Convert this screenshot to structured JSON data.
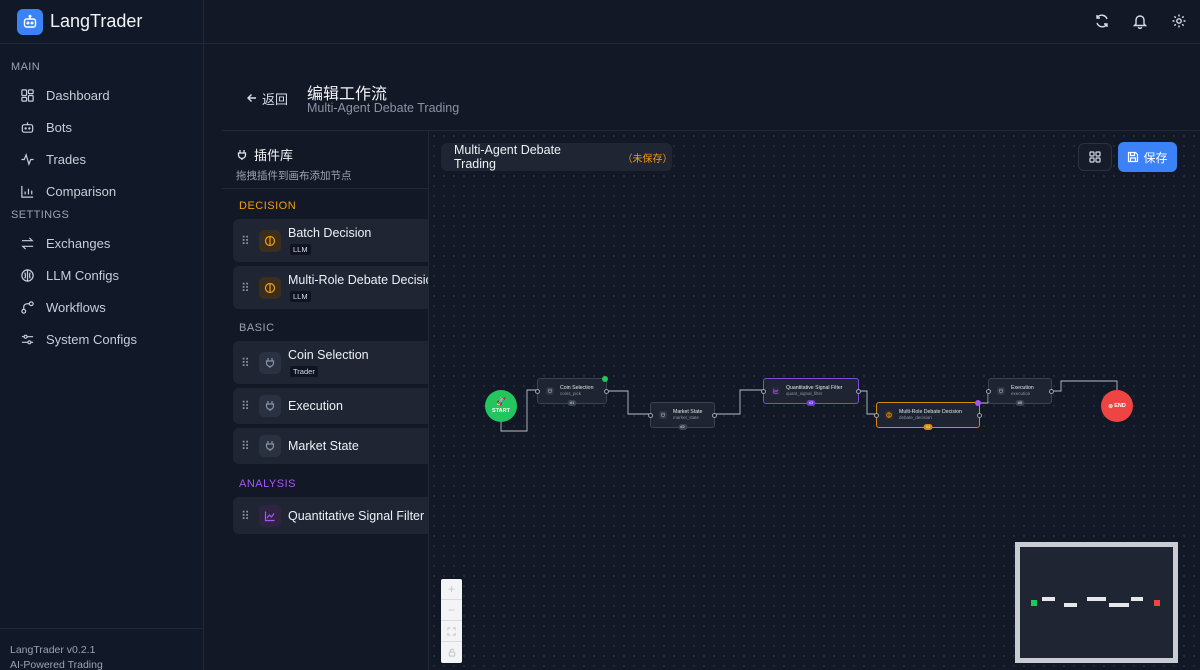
{
  "app": {
    "name": "LangTrader",
    "version": "LangTrader v0.2.1",
    "tagline": "AI-Powered Trading"
  },
  "sidebar": {
    "sections": [
      {
        "label": "MAIN",
        "items": [
          {
            "label": "Dashboard",
            "icon": "dashboard-icon"
          },
          {
            "label": "Bots",
            "icon": "bot-icon"
          },
          {
            "label": "Trades",
            "icon": "activity-icon"
          },
          {
            "label": "Comparison",
            "icon": "bar-chart-icon"
          }
        ]
      },
      {
        "label": "SETTINGS",
        "items": [
          {
            "label": "Exchanges",
            "icon": "swap-icon"
          },
          {
            "label": "LLM Configs",
            "icon": "brain-icon"
          },
          {
            "label": "Workflows",
            "icon": "workflow-icon"
          },
          {
            "label": "System Configs",
            "icon": "sliders-icon"
          }
        ]
      }
    ]
  },
  "topbar": {
    "icons": [
      "refresh-icon",
      "bell-icon",
      "gear-icon"
    ]
  },
  "header": {
    "back_label": "返回",
    "title": "编辑工作流",
    "subtitle": "Multi-Agent Debate Trading"
  },
  "plugin_panel": {
    "title": "插件库",
    "hint": "拖拽插件到画布添加节点",
    "categories": [
      {
        "label": "DECISION",
        "color": "#f59e0b",
        "plugins": [
          {
            "name": "Batch Decision",
            "badge": "LLM"
          },
          {
            "name": "Multi-Role Debate Decision",
            "badge": "LLM"
          }
        ]
      },
      {
        "label": "BASIC",
        "color": "#9ca3af",
        "plugins": [
          {
            "name": "Coin Selection",
            "badge": "Trader"
          },
          {
            "name": "Execution",
            "badge": ""
          },
          {
            "name": "Market State",
            "badge": ""
          }
        ]
      },
      {
        "label": "ANALYSIS",
        "color": "#a855f7",
        "plugins": [
          {
            "name": "Quantitative Signal Filter",
            "badge": ""
          }
        ]
      }
    ]
  },
  "workflow": {
    "name": "Multi-Agent Debate Trading",
    "status": "（未保存）",
    "save_label": "保存"
  },
  "flow": {
    "start_label": "START",
    "end_label": "END",
    "nodes": [
      {
        "title": "Coin Selection",
        "sub": "coins_pick",
        "badge": "#1"
      },
      {
        "title": "Market State",
        "sub": "market_state",
        "badge": "#2"
      },
      {
        "title": "Quantitative Signal Filter",
        "sub": "quant_signal_filter",
        "badge": "#3"
      },
      {
        "title": "Multi-Role Debate Decision",
        "sub": "debate_decision",
        "badge": "#4"
      },
      {
        "title": "Execution",
        "sub": "execution",
        "badge": "#5"
      }
    ]
  },
  "colors": {
    "accent": "#3b82f6",
    "decision": "#f59e0b",
    "analysis": "#a855f7",
    "start": "#22c55e",
    "end": "#ef4444"
  }
}
